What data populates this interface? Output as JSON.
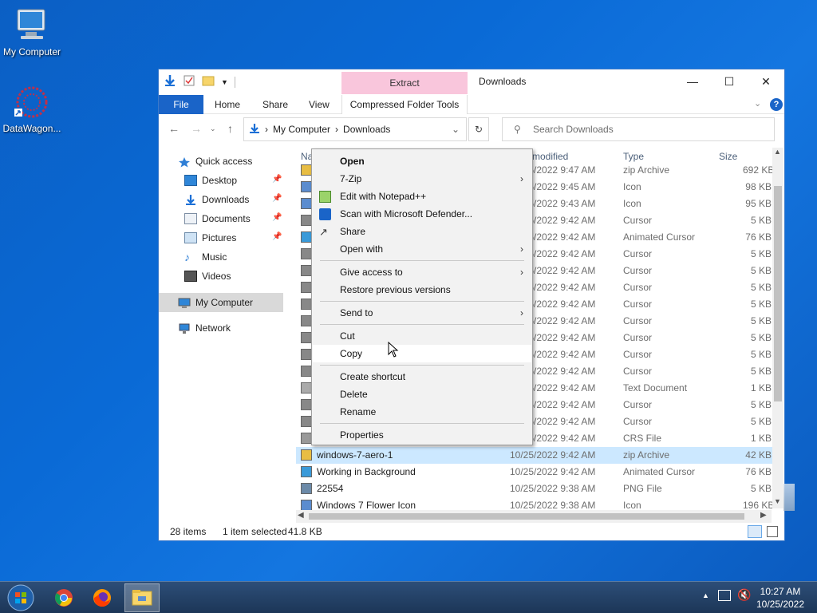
{
  "desktop": {
    "icons": [
      {
        "label": "My Computer"
      },
      {
        "label": "DataWagon..."
      }
    ]
  },
  "window": {
    "title": "Downloads",
    "contextual_tab": "Extract",
    "ribbon_tabs": [
      "File",
      "Home",
      "Share",
      "View"
    ],
    "contextual_group": "Compressed Folder Tools",
    "address": {
      "root": "My Computer",
      "folder": "Downloads"
    },
    "search_placeholder": "Search Downloads"
  },
  "nav": {
    "quick_access": "Quick access",
    "items": [
      {
        "label": "Desktop",
        "pinned": true
      },
      {
        "label": "Downloads",
        "pinned": true
      },
      {
        "label": "Documents",
        "pinned": true
      },
      {
        "label": "Pictures",
        "pinned": true
      },
      {
        "label": "Music",
        "pinned": false
      },
      {
        "label": "Videos",
        "pinned": false
      }
    ],
    "my_computer": "My Computer",
    "network": "Network"
  },
  "columns": {
    "name": "Na",
    "date": "modified",
    "type": "Type",
    "size": "Size"
  },
  "rows": [
    {
      "name": "",
      "date": "10/25/2022 9:47 AM",
      "type": "zip Archive",
      "size": "692 KB"
    },
    {
      "name": "",
      "date": "10/25/2022 9:45 AM",
      "type": "Icon",
      "size": "98 KB"
    },
    {
      "name": "",
      "date": "10/25/2022 9:43 AM",
      "type": "Icon",
      "size": "95 KB"
    },
    {
      "name": "",
      "date": "10/25/2022 9:42 AM",
      "type": "Cursor",
      "size": "5 KB"
    },
    {
      "name": "",
      "date": "10/25/2022 9:42 AM",
      "type": "Animated Cursor",
      "size": "76 KB"
    },
    {
      "name": "",
      "date": "10/25/2022 9:42 AM",
      "type": "Cursor",
      "size": "5 KB"
    },
    {
      "name": "",
      "date": "10/25/2022 9:42 AM",
      "type": "Cursor",
      "size": "5 KB"
    },
    {
      "name": "",
      "date": "10/25/2022 9:42 AM",
      "type": "Cursor",
      "size": "5 KB"
    },
    {
      "name": "",
      "date": "10/25/2022 9:42 AM",
      "type": "Cursor",
      "size": "5 KB"
    },
    {
      "name": "",
      "date": "10/25/2022 9:42 AM",
      "type": "Cursor",
      "size": "5 KB"
    },
    {
      "name": "",
      "date": "10/25/2022 9:42 AM",
      "type": "Cursor",
      "size": "5 KB"
    },
    {
      "name": "",
      "date": "10/25/2022 9:42 AM",
      "type": "Cursor",
      "size": "5 KB"
    },
    {
      "name": "",
      "date": "10/25/2022 9:42 AM",
      "type": "Cursor",
      "size": "5 KB"
    },
    {
      "name": "",
      "date": "10/25/2022 9:42 AM",
      "type": "Text Document",
      "size": "1 KB"
    },
    {
      "name": "",
      "date": "10/25/2022 9:42 AM",
      "type": "Cursor",
      "size": "5 KB"
    },
    {
      "name": "",
      "date": "10/25/2022 9:42 AM",
      "type": "Cursor",
      "size": "5 KB"
    },
    {
      "name": "",
      "date": "10/25/2022 9:42 AM",
      "type": "CRS File",
      "size": "1 KB"
    },
    {
      "name": "windows-7-aero-1",
      "date": "10/25/2022 9:42 AM",
      "type": "zip Archive",
      "size": "42 KB"
    },
    {
      "name": "Working in Background",
      "date": "10/25/2022 9:42 AM",
      "type": "Animated Cursor",
      "size": "76 KB"
    },
    {
      "name": "22554",
      "date": "10/25/2022 9:38 AM",
      "type": "PNG File",
      "size": "5 KB"
    },
    {
      "name": "Windows 7 Flower Icon",
      "date": "10/25/2022 9:38 AM",
      "type": "Icon",
      "size": "196 KB"
    }
  ],
  "status": {
    "count": "28 items",
    "selection": "1 item selected",
    "size": "41.8 KB"
  },
  "context_menu": [
    {
      "label": "Open",
      "bold": true
    },
    {
      "label": "7-Zip",
      "submenu": true
    },
    {
      "label": "Edit with Notepad++"
    },
    {
      "label": "Scan with Microsoft Defender..."
    },
    {
      "label": "Share"
    },
    {
      "label": "Open with",
      "submenu": true
    },
    {
      "label": "Give access to",
      "submenu": true
    },
    {
      "label": "Restore previous versions"
    },
    {
      "label": "Send to",
      "submenu": true
    },
    {
      "label": "Cut"
    },
    {
      "label": "Copy",
      "highlighted": true
    },
    {
      "label": "Create shortcut"
    },
    {
      "label": "Delete"
    },
    {
      "label": "Rename"
    },
    {
      "label": "Properties"
    }
  ],
  "taskbar": {
    "time": "10:27 AM",
    "date": "10/25/2022"
  }
}
